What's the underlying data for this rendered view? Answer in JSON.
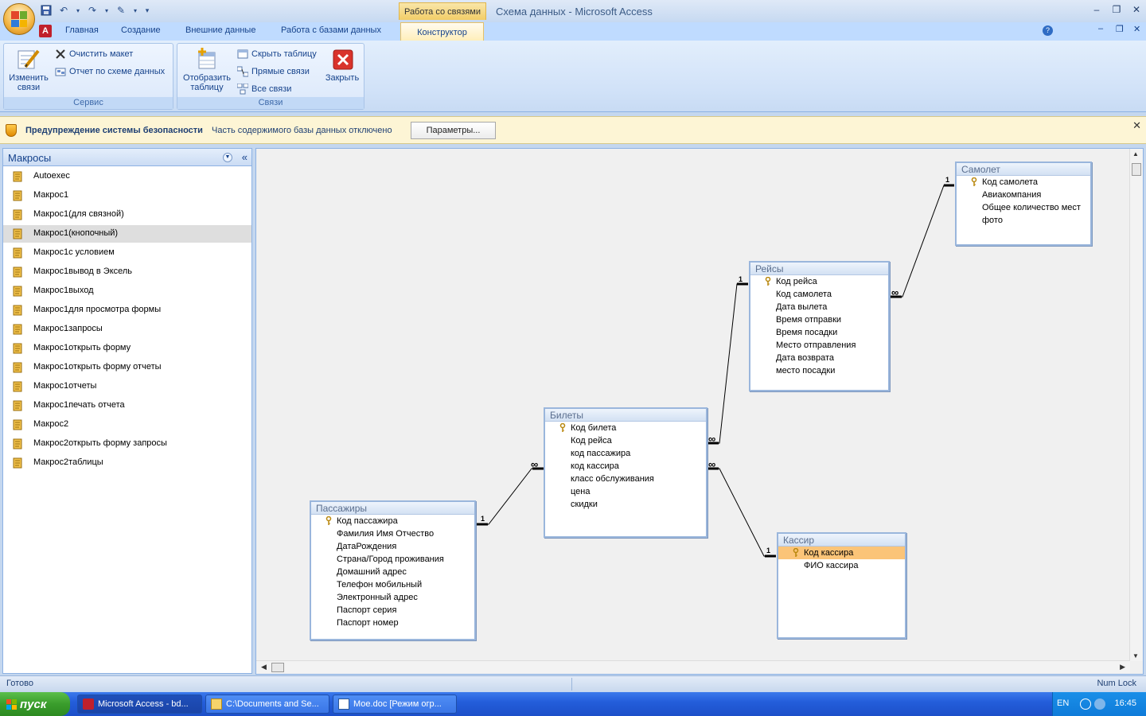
{
  "window": {
    "title": "Схема данных - Microsoft Access",
    "context_group": "Работа со связями"
  },
  "tabs": [
    {
      "label": "Главная"
    },
    {
      "label": "Создание"
    },
    {
      "label": "Внешние данные"
    },
    {
      "label": "Работа с базами данных"
    },
    {
      "label": "Конструктор"
    }
  ],
  "ribbon": {
    "service": {
      "label": "Сервис",
      "edit_relationships": "Изменить связи",
      "clear_layout": "Очистить макет",
      "schema_report": "Отчет по схеме данных"
    },
    "relationships": {
      "label": "Связи",
      "show_table": "Отобразить таблицу",
      "hide_table": "Скрыть таблицу",
      "direct_relationships": "Прямые связи",
      "all_relationships": "Все связи",
      "close": "Закрыть"
    }
  },
  "security_bar": {
    "title": "Предупреждение системы безопасности",
    "message": "Часть содержимого базы данных отключено",
    "button": "Параметры..."
  },
  "nav": {
    "title": "Макросы",
    "selected_index": 3,
    "items": [
      "Autoexec",
      "Макрос1",
      "Макрос1(для связной)",
      "Макрос1(кнопочный)",
      "Макрос1с условием",
      "Макрос1вывод в Эксель",
      "Макрос1выход",
      "Макрос1для просмотра формы",
      "Макрос1запросы",
      "Макрос1открыть форму",
      "Макрос1открыть форму отчеты",
      "Макрос1отчеты",
      "Макрос1печать отчета",
      "Макрос2",
      "Макрос2открыть форму запросы",
      "Макрос2таблицы"
    ]
  },
  "tables": {
    "samolet": {
      "title": "Самолет",
      "fields": [
        "Код самолета",
        "Авиакомпания",
        "Общее количество мест",
        "фото"
      ]
    },
    "reysy": {
      "title": "Рейсы",
      "fields": [
        "Код рейса",
        "Код самолета",
        "Дата вылета",
        "Время отправки",
        "Время посадки",
        "Место отправления",
        "Дата возврата",
        "место посадки"
      ]
    },
    "bilety": {
      "title": "Билеты",
      "fields": [
        "Код билета",
        "Код рейса",
        "код пассажира",
        "код кассира",
        "класс обслуживания",
        "цена",
        "скидки"
      ]
    },
    "passazhiry": {
      "title": "Пассажиры",
      "fields": [
        "Код пассажира",
        "Фамилия Имя Отчество",
        "ДатаРождения",
        "Страна/Город проживания",
        "Домашний адрес",
        "Телефон мобильный",
        "Электронный адрес",
        "Паспорт серия",
        "Паспорт номер"
      ]
    },
    "kassir": {
      "title": "Кассир",
      "fields": [
        "Код кассира",
        "ФИО кассира"
      ]
    }
  },
  "relation_labels": {
    "one": "1",
    "many": "∞"
  },
  "status": {
    "text": "Готово",
    "numlock": "Num Lock"
  },
  "taskbar": {
    "start": "пуск",
    "tasks": [
      "Microsoft Access - bd...",
      "C:\\Documents and Se...",
      "Мое.doc [Режим огр..."
    ],
    "lang": "EN",
    "clock": "16:45"
  }
}
